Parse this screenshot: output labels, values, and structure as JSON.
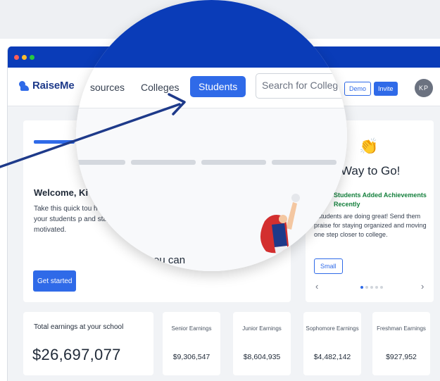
{
  "brand": {
    "name": "RaiseMe"
  },
  "nav": {
    "resources_partial": "sources",
    "colleges": "Colleges",
    "students": "Students",
    "search_placeholder": "Search for Colleg",
    "demo": "Demo",
    "invite": "Invite",
    "avatar_initials": "KP"
  },
  "welcome": {
    "title": "Welcome, Ki",
    "body": "Take this quick tou help your students p and stay motivated.",
    "cta": "Get started",
    "partial_text": "ou can"
  },
  "achievements": {
    "emoji": "👏",
    "title": "Way to Go!",
    "added": "Students Added Achievements Recently",
    "body": "r students are doing great! Send them praise for staying organized and moving one step closer to college.",
    "button": "Small",
    "prev": "‹",
    "next": "›",
    "slides": 5,
    "active_slide": 1
  },
  "earnings": {
    "total_label": "Total earnings at your school",
    "total_value": "$26,697,077",
    "classes": [
      {
        "label": "Senior Earnings",
        "value": "$9,306,547"
      },
      {
        "label": "Junior Earnings",
        "value": "$8,604,935"
      },
      {
        "label": "Sophomore Earnings",
        "value": "$4,482,142"
      },
      {
        "label": "Freshman Earnings",
        "value": "$927,952"
      }
    ]
  },
  "colors": {
    "titlebar": "#0a3cb8",
    "primary": "#2f6ae8",
    "arrow": "#1e3a8a",
    "success": "#15803d"
  }
}
